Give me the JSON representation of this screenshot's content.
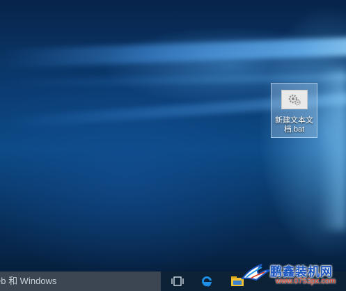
{
  "desktop": {
    "icons": [
      {
        "label": "新建文本文档.bat",
        "icon": "batch-file-gear-icon"
      }
    ]
  },
  "taskbar": {
    "search_text": "eb 和 Windows",
    "task_view_icon": "task-view-icon",
    "edge_icon": "edge-browser-icon",
    "explorer_icon": "file-explorer-icon"
  },
  "watermark": {
    "title": "鹏鑫装机网",
    "url": "www.0753px.com"
  },
  "colors": {
    "taskbar_bg": "#0e2236",
    "search_bg": "#3b4652",
    "edge_blue": "#1e90e8",
    "folder_yellow": "#f2c230"
  }
}
